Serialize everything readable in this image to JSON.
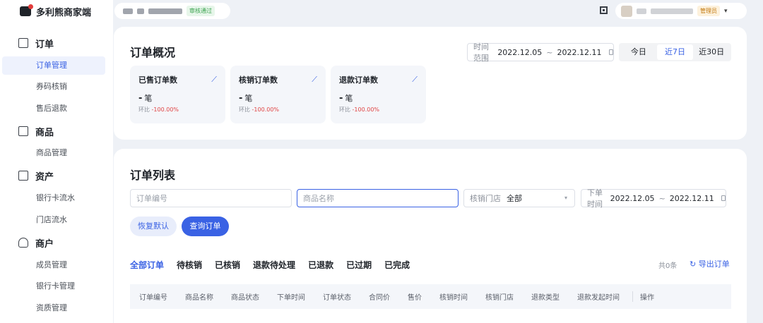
{
  "brand": {
    "name": "多利熊商家端"
  },
  "topbar": {
    "audit_status": "审核通过",
    "role": "管理员"
  },
  "sidebar": {
    "groups": [
      {
        "label": "订单",
        "items": [
          "订单管理",
          "券码核销",
          "售后退款"
        ]
      },
      {
        "label": "商品",
        "items": [
          "商品管理"
        ]
      },
      {
        "label": "资产",
        "items": [
          "银行卡流水",
          "门店流水"
        ]
      },
      {
        "label": "商户",
        "items": [
          "成员管理",
          "银行卡管理",
          "资质管理"
        ]
      }
    ],
    "active_item": "订单管理"
  },
  "overview": {
    "title": "订单概况",
    "range_label": "时间范围",
    "range_start": "2022.12.05",
    "range_end": "2022.12.11",
    "range_sep": "~",
    "quick": [
      "今日",
      "近7日",
      "近30日"
    ],
    "quick_active": "近7日",
    "stats": [
      {
        "title": "已售订单数",
        "value": "-",
        "unit": "笔",
        "ratio_label": "环比",
        "ratio": "-100.00%"
      },
      {
        "title": "核销订单数",
        "value": "-",
        "unit": "笔",
        "ratio_label": "环比",
        "ratio": "-100.00%"
      },
      {
        "title": "退款订单数",
        "value": "-",
        "unit": "笔",
        "ratio_label": "环比",
        "ratio": "-100.00%"
      }
    ]
  },
  "orders": {
    "title": "订单列表",
    "filters": {
      "order_no_placeholder": "订单编号",
      "product_placeholder": "商品名称",
      "store_label": "核销门店",
      "store_value": "全部",
      "time_label": "下单时间",
      "time_start": "2022.12.05",
      "time_end": "2022.12.11",
      "time_sep": "~"
    },
    "buttons": {
      "reset": "恢复默认",
      "query": "查询订单"
    },
    "tabs": [
      "全部订单",
      "待核销",
      "已核销",
      "退款待处理",
      "已退款",
      "已过期",
      "已完成"
    ],
    "active_tab": "全部订单",
    "total": "共0条",
    "export": "导出订单",
    "columns": [
      "订单编号",
      "商品名称",
      "商品状态",
      "下单时间",
      "订单状态",
      "合同价",
      "售价",
      "核销时间",
      "核销门店",
      "退款类型",
      "退款发起时间",
      "操作"
    ]
  },
  "colors": {
    "accent": "#3a62e4",
    "danger": "#e04444",
    "bg": "#eef1f6"
  }
}
